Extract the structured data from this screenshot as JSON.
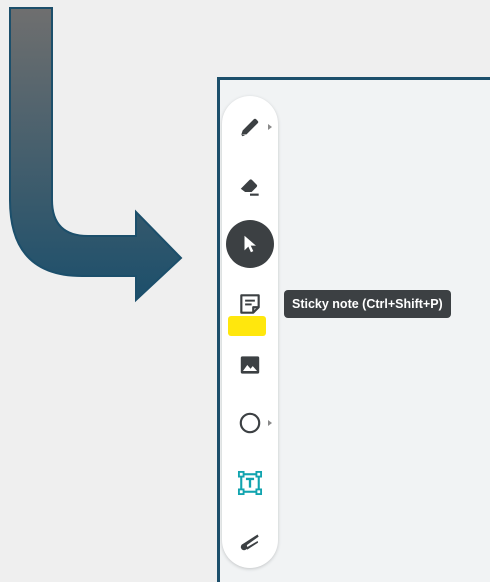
{
  "tooltip": {
    "text": "Sticky note (Ctrl+Shift+P)"
  },
  "toolbar": {
    "tools": [
      {
        "name": "pen",
        "icon": "pen-icon",
        "has_menu": true
      },
      {
        "name": "eraser",
        "icon": "eraser-icon",
        "has_menu": false
      },
      {
        "name": "select",
        "icon": "cursor-arrow-icon",
        "active": true
      },
      {
        "name": "sticky-note",
        "icon": "sticky-note-icon",
        "hovered": true
      },
      {
        "name": "image",
        "icon": "image-icon"
      },
      {
        "name": "shape",
        "icon": "circle-icon",
        "has_menu": true
      },
      {
        "name": "text-box",
        "icon": "text-box-icon"
      },
      {
        "name": "laser",
        "icon": "laser-icon"
      }
    ]
  },
  "colors": {
    "arrow_top": "#6f6f6f",
    "arrow_bottom": "#1c4f6b",
    "frame_border": "#1c4f6b",
    "active_tool_bg": "#3c4043",
    "text_box_accent": "#12a4af",
    "highlight": "#ffe600",
    "tooltip_bg": "#3c4043"
  }
}
